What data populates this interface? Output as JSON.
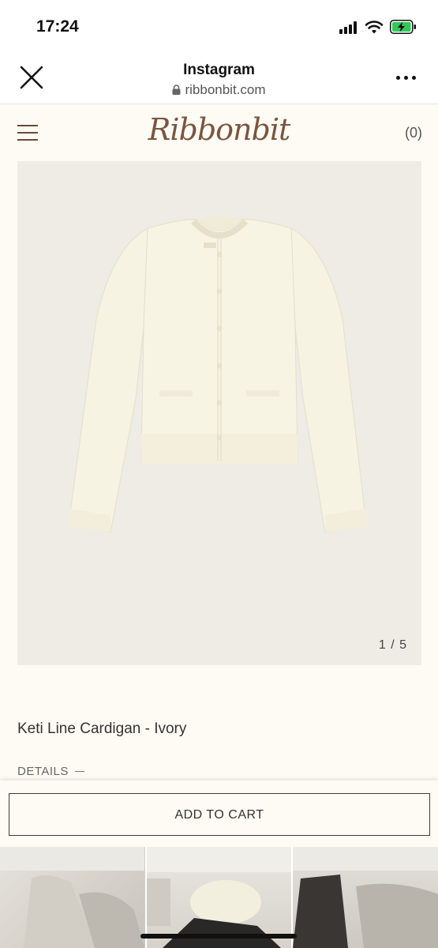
{
  "status_bar": {
    "time": "17:24",
    "icons": [
      "signal-icon",
      "wifi-icon",
      "battery-charging-icon"
    ],
    "battery_color": "#34c759"
  },
  "browser": {
    "title": "Instagram",
    "url": "ribbonbit.com",
    "close_icon": "close-icon",
    "more_icon": "more-icon"
  },
  "site": {
    "logo": "Ribbonbit",
    "cart_count": "(0)",
    "menu_icon": "hamburger-icon",
    "accent_color": "#7b5540"
  },
  "product": {
    "image_counter": "1 / 5",
    "name": "Keti Line Cardigan - Ivory",
    "details_label": "DETAILS"
  },
  "cart": {
    "add_to_cart_label": "ADD TO CART"
  }
}
